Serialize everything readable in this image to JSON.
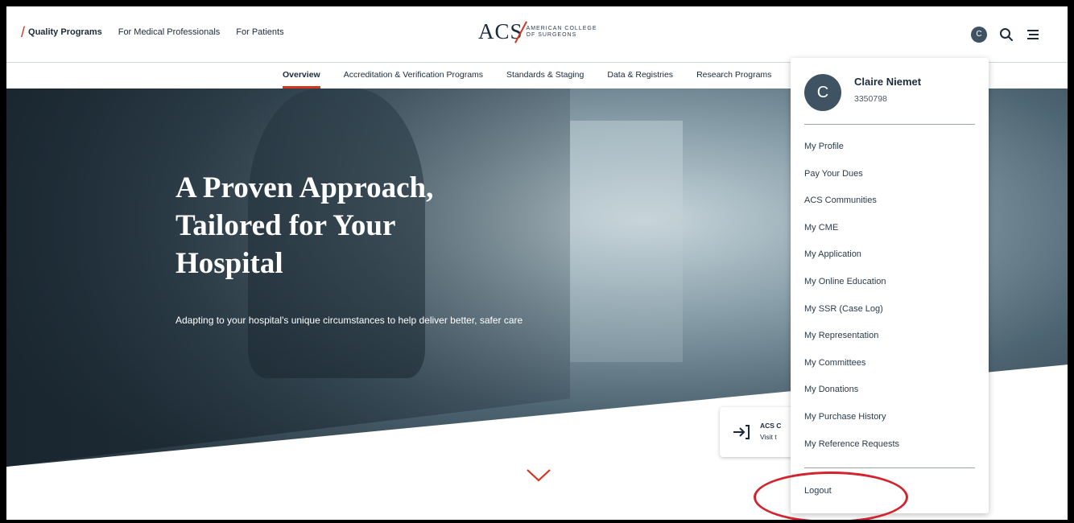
{
  "header": {
    "links": [
      {
        "label": "Quality Programs",
        "active": true
      },
      {
        "label": "For Medical Professionals",
        "active": false
      },
      {
        "label": "For Patients",
        "active": false
      }
    ],
    "logo": {
      "acs": "ACS",
      "line1": "AMERICAN COLLEGE",
      "line2": "OF SURGEONS"
    },
    "avatar_initial": "C",
    "icons": {
      "search": "search-icon",
      "menu": "hamburger-menu-icon"
    }
  },
  "subnav": {
    "items": [
      {
        "label": "Overview",
        "active": true
      },
      {
        "label": "Accreditation & Verification Programs",
        "active": false
      },
      {
        "label": "Standards & Staging",
        "active": false
      },
      {
        "label": "Data & Registries",
        "active": false
      },
      {
        "label": "Research Programs",
        "active": false
      }
    ]
  },
  "hero": {
    "title_lines": [
      "A Proven Approach,",
      "Tailored for Your",
      "Hospital"
    ],
    "description": "Adapting to your hospital's unique circumstances to help deliver better, safer care"
  },
  "callout": {
    "title": "ACS C",
    "subtitle": "Visit t"
  },
  "user_menu": {
    "avatar_initial": "C",
    "name": "Claire Niemet",
    "id": "3350798",
    "items": [
      "My Profile",
      "Pay Your Dues",
      "ACS Communities",
      "My CME",
      "My Application",
      "My Online Education",
      "My SSR (Case Log)",
      "My Representation",
      "My Committees",
      "My Donations",
      "My Purchase History",
      "My Reference Requests"
    ],
    "logout": "Logout"
  },
  "colors": {
    "accent": "#d2361f",
    "navy": "#1b2a3a",
    "highlight_ring": "#d3232e"
  }
}
